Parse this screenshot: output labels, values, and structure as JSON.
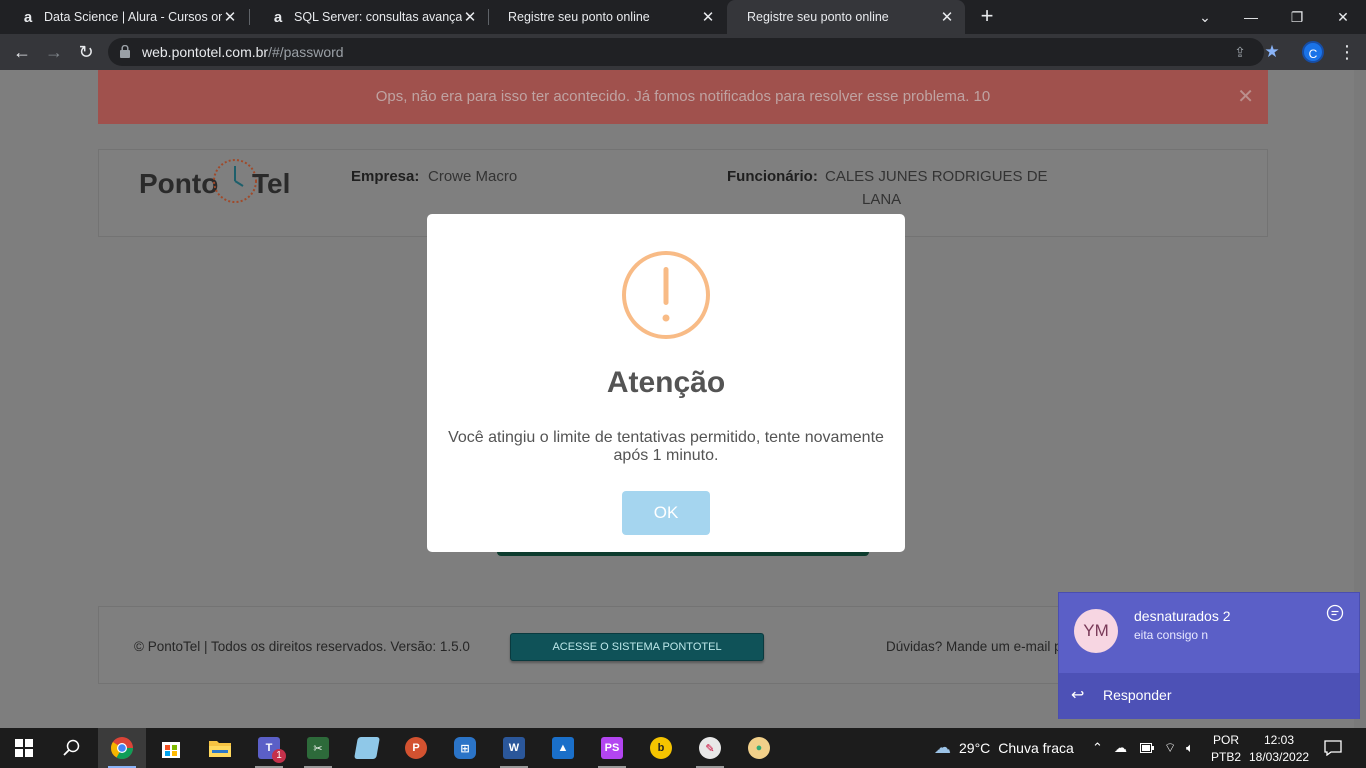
{
  "browser": {
    "tabs": [
      {
        "favicon": "a",
        "title": "Data Science | Alura - Cursos onli",
        "active": false
      },
      {
        "favicon": "a",
        "title": "SQL Server: consultas avançadas",
        "active": false
      },
      {
        "favicon": "page",
        "title": "Registre seu ponto online",
        "active": false
      },
      {
        "favicon": "page",
        "title": "Registre seu ponto online",
        "active": true
      }
    ],
    "url_host": "web.pontotel.com.br",
    "url_path": "/#/password",
    "profile_initial": "C"
  },
  "page": {
    "alert_text": "Ops, não era para isso ter acontecido. Já fomos notificados para resolver esse problema. 10",
    "header": {
      "logo_text_left": "Ponto",
      "logo_text_right": "Tel",
      "empresa_label": "Empresa:",
      "empresa_value": "Crowe Macro",
      "funcionario_label": "Funcionário:",
      "funcionario_line1": "CALES JUNES RODRIGUES DE",
      "funcionario_line2": "LANA"
    },
    "footer": {
      "copyright": "© PontoTel | Todos os direitos reservados. Versão: 1.5.0",
      "access_button": "ACESSE O SISTEMA PONTOTEL",
      "help_text": "Dúvidas? Mande um e-mail p"
    }
  },
  "modal": {
    "title": "Atenção",
    "text": "Você atingiu o limite de tentativas permitido, tente novamente após 1 minuto.",
    "ok_label": "OK"
  },
  "notification": {
    "avatar_initials": "YM",
    "sender": "desnaturados 2",
    "message": "eita consigo n",
    "reply_label": "Responder"
  },
  "taskbar": {
    "apps": [
      "windows-start",
      "search",
      "chrome",
      "microsoft-store",
      "file-explorer",
      "teams",
      "snipping-tool",
      "notepad",
      "powerpoint",
      "remote-app",
      "word",
      "photos",
      "phpstorm",
      "bandicam",
      "paint",
      "paint-3d"
    ],
    "teams_badge": "1",
    "weather_temp": "29°C",
    "weather_desc": "Chuva fraca",
    "lang_1": "POR",
    "lang_2": "PTB2",
    "time": "12:03",
    "date": "18/03/2022"
  }
}
